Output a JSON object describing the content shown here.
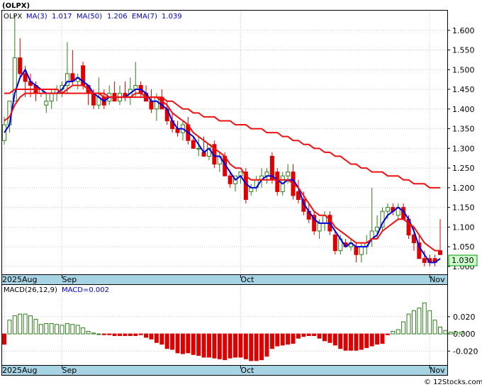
{
  "symbol_label": "(OLPX)",
  "legend": {
    "ticker": "OLPX",
    "items": [
      {
        "label": "MA(3)",
        "value": "1.017",
        "color": "#0000cc"
      },
      {
        "label": "MA(50)",
        "value": "1.206",
        "color": "#0000cc"
      },
      {
        "label": "EMA(7)",
        "value": "1.039",
        "color": "#0000cc"
      }
    ]
  },
  "macd_legend": {
    "label": "MACD(26,12,9)",
    "value_label": "MACD=0.002",
    "label_color": "#000000",
    "value_color": "#0000cc"
  },
  "last_price_tag": "1.030",
  "watermark": "© 12Stocks.com",
  "colors": {
    "up": "#2e7d1a",
    "down": "#dd0000",
    "ma_short": "#0000dd",
    "ma_long": "#ee1111",
    "axis_band": "#a6d4e4",
    "grid": "#c8c8c8",
    "price_tag_bg": "#ccffcc",
    "price_tag_fg": "#006600"
  },
  "chart_data": [
    {
      "type": "candlestick",
      "title": "(OLPX)",
      "ylim": [
        0.98,
        1.65
      ],
      "yticks": [
        "1.000",
        "1.050",
        "1.100",
        "1.150",
        "1.200",
        "1.250",
        "1.300",
        "1.350",
        "1.400",
        "1.450",
        "1.500",
        "1.550",
        "1.600"
      ],
      "xtick_labels": [
        {
          "label": "2025Aug",
          "index": 0
        },
        {
          "label": "Sep",
          "index": 11
        },
        {
          "label": "Oct",
          "index": 45
        },
        {
          "label": "Nov",
          "index": 81
        }
      ],
      "grid": true,
      "ohlc": [
        [
          1.32,
          1.38,
          1.31,
          1.36
        ],
        [
          1.36,
          1.42,
          1.34,
          1.42
        ],
        [
          1.42,
          1.64,
          1.42,
          1.53
        ],
        [
          1.53,
          1.58,
          1.48,
          1.49
        ],
        [
          1.49,
          1.51,
          1.43,
          1.47
        ],
        [
          1.47,
          1.49,
          1.43,
          1.46
        ],
        [
          1.46,
          1.47,
          1.42,
          1.44
        ],
        [
          1.44,
          1.45,
          1.43,
          1.45
        ],
        [
          1.41,
          1.44,
          1.39,
          1.42
        ],
        [
          1.42,
          1.45,
          1.4,
          1.44
        ],
        [
          1.44,
          1.46,
          1.42,
          1.45
        ],
        [
          1.45,
          1.47,
          1.43,
          1.46
        ],
        [
          1.46,
          1.57,
          1.44,
          1.49
        ],
        [
          1.49,
          1.55,
          1.46,
          1.47
        ],
        [
          1.47,
          1.49,
          1.45,
          1.48
        ],
        [
          1.51,
          1.52,
          1.45,
          1.46
        ],
        [
          1.46,
          1.46,
          1.41,
          1.44
        ],
        [
          1.44,
          1.45,
          1.4,
          1.41
        ],
        [
          1.41,
          1.48,
          1.4,
          1.43
        ],
        [
          1.43,
          1.45,
          1.4,
          1.41
        ],
        [
          1.42,
          1.46,
          1.41,
          1.44
        ],
        [
          1.44,
          1.47,
          1.42,
          1.42
        ],
        [
          1.42,
          1.46,
          1.41,
          1.44
        ],
        [
          1.44,
          1.47,
          1.42,
          1.43
        ],
        [
          1.43,
          1.48,
          1.41,
          1.45
        ],
        [
          1.45,
          1.52,
          1.43,
          1.46
        ],
        [
          1.46,
          1.47,
          1.43,
          1.44
        ],
        [
          1.44,
          1.46,
          1.42,
          1.42
        ],
        [
          1.42,
          1.45,
          1.39,
          1.4
        ],
        [
          1.4,
          1.44,
          1.37,
          1.43
        ],
        [
          1.43,
          1.45,
          1.4,
          1.4
        ],
        [
          1.4,
          1.42,
          1.36,
          1.37
        ],
        [
          1.37,
          1.39,
          1.34,
          1.35
        ],
        [
          1.35,
          1.37,
          1.33,
          1.34
        ],
        [
          1.34,
          1.37,
          1.32,
          1.36
        ],
        [
          1.36,
          1.38,
          1.31,
          1.32
        ],
        [
          1.32,
          1.33,
          1.3,
          1.3
        ],
        [
          1.3,
          1.33,
          1.28,
          1.3
        ],
        [
          1.29,
          1.33,
          1.28,
          1.28
        ],
        [
          1.28,
          1.31,
          1.27,
          1.31
        ],
        [
          1.31,
          1.32,
          1.25,
          1.26
        ],
        [
          1.26,
          1.29,
          1.24,
          1.28
        ],
        [
          1.28,
          1.29,
          1.23,
          1.23
        ],
        [
          1.23,
          1.24,
          1.2,
          1.21
        ],
        [
          1.21,
          1.23,
          1.19,
          1.23
        ],
        [
          1.23,
          1.24,
          1.21,
          1.24
        ],
        [
          1.24,
          1.25,
          1.16,
          1.17
        ],
        [
          1.19,
          1.21,
          1.18,
          1.2
        ],
        [
          1.2,
          1.23,
          1.19,
          1.22
        ],
        [
          1.22,
          1.25,
          1.2,
          1.23
        ],
        [
          1.23,
          1.25,
          1.21,
          1.24
        ],
        [
          1.28,
          1.29,
          1.21,
          1.22
        ],
        [
          1.24,
          1.25,
          1.18,
          1.19
        ],
        [
          1.19,
          1.24,
          1.18,
          1.23
        ],
        [
          1.23,
          1.26,
          1.21,
          1.24
        ],
        [
          1.24,
          1.26,
          1.17,
          1.18
        ],
        [
          1.19,
          1.22,
          1.16,
          1.17
        ],
        [
          1.17,
          1.19,
          1.13,
          1.14
        ],
        [
          1.14,
          1.16,
          1.11,
          1.12
        ],
        [
          1.13,
          1.14,
          1.08,
          1.09
        ],
        [
          1.09,
          1.12,
          1.07,
          1.11
        ],
        [
          1.11,
          1.14,
          1.09,
          1.13
        ],
        [
          1.13,
          1.14,
          1.08,
          1.09
        ],
        [
          1.08,
          1.09,
          1.03,
          1.04
        ],
        [
          1.04,
          1.08,
          1.03,
          1.07
        ],
        [
          1.06,
          1.07,
          1.05,
          1.05
        ],
        [
          1.05,
          1.07,
          1.04,
          1.06
        ],
        [
          1.05,
          1.06,
          1.01,
          1.03
        ],
        [
          1.03,
          1.06,
          1.01,
          1.05
        ],
        [
          1.05,
          1.08,
          1.03,
          1.06
        ],
        [
          1.07,
          1.2,
          1.05,
          1.09
        ],
        [
          1.09,
          1.13,
          1.07,
          1.1
        ],
        [
          1.1,
          1.15,
          1.09,
          1.14
        ],
        [
          1.14,
          1.16,
          1.12,
          1.15
        ],
        [
          1.15,
          1.16,
          1.13,
          1.14
        ],
        [
          1.13,
          1.16,
          1.12,
          1.15
        ],
        [
          1.15,
          1.16,
          1.12,
          1.12
        ],
        [
          1.12,
          1.13,
          1.07,
          1.08
        ],
        [
          1.08,
          1.1,
          1.04,
          1.06
        ],
        [
          1.06,
          1.08,
          1.02,
          1.02
        ],
        [
          1.02,
          1.04,
          1.0,
          1.01
        ],
        [
          1.02,
          1.03,
          1.0,
          1.01
        ],
        [
          1.02,
          1.03,
          1.0,
          1.01
        ],
        [
          1.04,
          1.12,
          1.03,
          1.03
        ]
      ],
      "series": [
        {
          "name": "MA(3)",
          "values": [
            1.34,
            1.36,
            1.44,
            1.48,
            1.5,
            1.47,
            1.46,
            1.45,
            1.44,
            1.44,
            1.44,
            1.45,
            1.47,
            1.47,
            1.48,
            1.47,
            1.46,
            1.44,
            1.43,
            1.42,
            1.43,
            1.43,
            1.43,
            1.43,
            1.44,
            1.45,
            1.45,
            1.44,
            1.42,
            1.42,
            1.41,
            1.4,
            1.37,
            1.35,
            1.35,
            1.34,
            1.33,
            1.31,
            1.29,
            1.3,
            1.28,
            1.28,
            1.26,
            1.24,
            1.22,
            1.23,
            1.21,
            1.2,
            1.2,
            1.22,
            1.23,
            1.23,
            1.22,
            1.21,
            1.22,
            1.22,
            1.2,
            1.16,
            1.14,
            1.12,
            1.11,
            1.11,
            1.11,
            1.09,
            1.07,
            1.05,
            1.06,
            1.05,
            1.05,
            1.05,
            1.07,
            1.08,
            1.11,
            1.13,
            1.14,
            1.15,
            1.14,
            1.12,
            1.09,
            1.05,
            1.03,
            1.01,
            1.01,
            1.02
          ]
        },
        {
          "name": "EMA(7)",
          "values": [
            1.37,
            1.38,
            1.41,
            1.43,
            1.44,
            1.44,
            1.44,
            1.44,
            1.44,
            1.44,
            1.44,
            1.44,
            1.45,
            1.46,
            1.46,
            1.46,
            1.45,
            1.44,
            1.44,
            1.43,
            1.43,
            1.43,
            1.43,
            1.43,
            1.43,
            1.44,
            1.44,
            1.43,
            1.43,
            1.43,
            1.42,
            1.41,
            1.39,
            1.38,
            1.37,
            1.36,
            1.34,
            1.33,
            1.32,
            1.31,
            1.3,
            1.29,
            1.28,
            1.26,
            1.25,
            1.25,
            1.23,
            1.22,
            1.22,
            1.22,
            1.22,
            1.22,
            1.22,
            1.22,
            1.22,
            1.21,
            1.2,
            1.18,
            1.16,
            1.14,
            1.13,
            1.13,
            1.12,
            1.1,
            1.09,
            1.08,
            1.07,
            1.06,
            1.06,
            1.06,
            1.07,
            1.07,
            1.09,
            1.1,
            1.11,
            1.12,
            1.12,
            1.11,
            1.1,
            1.08,
            1.06,
            1.05,
            1.04,
            1.04
          ]
        },
        {
          "name": "MA(50)",
          "values": [
            1.44,
            1.44,
            1.45,
            1.45,
            1.45,
            1.45,
            1.45,
            1.45,
            1.45,
            1.45,
            1.45,
            1.44,
            1.44,
            1.44,
            1.44,
            1.44,
            1.44,
            1.44,
            1.44,
            1.44,
            1.43,
            1.43,
            1.43,
            1.43,
            1.43,
            1.43,
            1.43,
            1.43,
            1.43,
            1.43,
            1.43,
            1.42,
            1.42,
            1.41,
            1.4,
            1.4,
            1.39,
            1.39,
            1.38,
            1.38,
            1.38,
            1.37,
            1.37,
            1.37,
            1.36,
            1.36,
            1.36,
            1.35,
            1.35,
            1.35,
            1.34,
            1.34,
            1.34,
            1.33,
            1.33,
            1.32,
            1.32,
            1.31,
            1.31,
            1.3,
            1.3,
            1.29,
            1.29,
            1.28,
            1.28,
            1.27,
            1.26,
            1.26,
            1.25,
            1.25,
            1.24,
            1.24,
            1.24,
            1.23,
            1.23,
            1.23,
            1.22,
            1.22,
            1.21,
            1.21,
            1.21,
            1.2,
            1.2,
            1.2
          ]
        }
      ]
    },
    {
      "type": "bar",
      "title": "MACD(26,12,9)",
      "ylim": [
        -0.032,
        0.042
      ],
      "yticks": [
        "0.020",
        "0.000",
        "-0.020"
      ],
      "grid": true,
      "values": [
        -0.012,
        0.016,
        0.021,
        0.023,
        0.023,
        0.021,
        0.017,
        0.011,
        0.012,
        0.012,
        0.011,
        0.01,
        0.012,
        0.011,
        0.01,
        0.007,
        0.003,
        0.001,
        0.0,
        -0.001,
        -0.001,
        -0.002,
        -0.002,
        -0.002,
        -0.002,
        -0.002,
        -0.001,
        -0.004,
        -0.006,
        -0.01,
        -0.012,
        -0.017,
        -0.018,
        -0.022,
        -0.023,
        -0.022,
        -0.024,
        -0.025,
        -0.027,
        -0.027,
        -0.028,
        -0.029,
        -0.03,
        -0.028,
        -0.027,
        -0.027,
        -0.029,
        -0.031,
        -0.031,
        -0.03,
        -0.026,
        -0.017,
        -0.014,
        -0.013,
        -0.012,
        -0.011,
        -0.005,
        -0.003,
        -0.002,
        -0.002,
        -0.005,
        -0.008,
        -0.01,
        -0.013,
        -0.017,
        -0.019,
        -0.019,
        -0.019,
        -0.018,
        -0.016,
        -0.014,
        -0.012,
        -0.011,
        -0.001,
        0.003,
        0.005,
        0.014,
        0.023,
        0.027,
        0.03,
        0.036,
        0.027,
        0.016,
        0.008,
        0.004,
        0.002,
        0.002,
        0.002
      ]
    }
  ]
}
